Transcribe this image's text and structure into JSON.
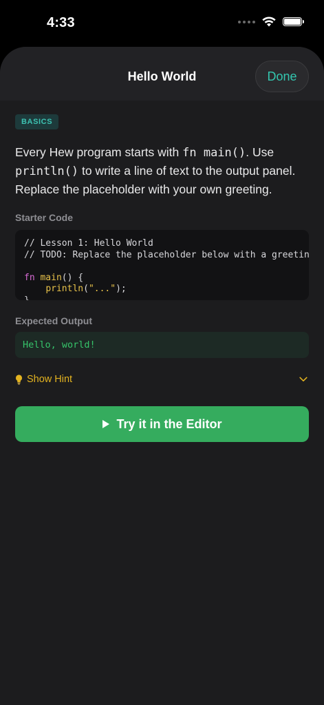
{
  "status_bar": {
    "time": "4:33"
  },
  "header": {
    "title": "Hello World",
    "done_label": "Done"
  },
  "lesson": {
    "badge": "BASICS",
    "intro_parts": {
      "p1": "Every Hew program starts with ",
      "code1": "fn main()",
      "p2": ". Use ",
      "code2": "println()",
      "p3": " to write a line of text to the output panel. Replace the placeholder with your own greeting."
    },
    "starter_label": "Starter Code",
    "code": {
      "line1": "// Lesson 1: Hello World",
      "line2": "// TODO: Replace the placeholder below with a greeting",
      "kw_fn": "fn",
      "fn_name": "main",
      "sig_rest": "() {",
      "indent": "    ",
      "call": "println",
      "paren_open": "(",
      "string": "\"...\"",
      "paren_close": ");",
      "close": "}"
    },
    "expected_label": "Expected Output",
    "expected_output": "Hello, world!",
    "hint_label": "Show Hint",
    "try_label": "Try it in the Editor"
  },
  "colors": {
    "accent_teal": "#33c7b0",
    "hint_yellow": "#e3b320",
    "button_green": "#35ac5e",
    "output_green": "#36c46a"
  },
  "icons": [
    "wifi-icon",
    "battery-icon",
    "lightbulb-icon",
    "chevron-down-icon",
    "play-icon"
  ]
}
